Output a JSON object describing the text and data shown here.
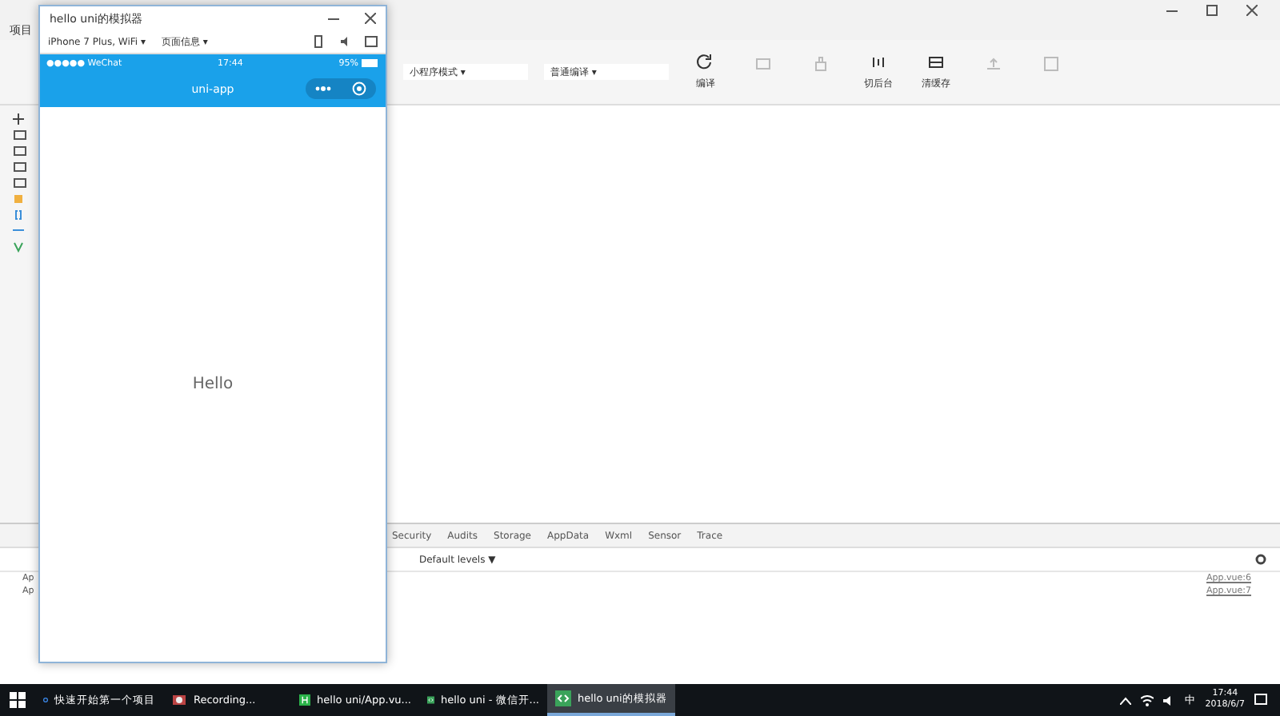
{
  "devtools": {
    "menu": "项目",
    "mode_select": "小程序模式",
    "mode_arrow": "▾",
    "compile_select": "普通编译",
    "compile_arrow": "▾",
    "toolbar": [
      {
        "label": "编译",
        "disabled": false
      },
      {
        "disabled": true
      },
      {
        "disabled": true
      },
      {
        "label": "切后台",
        "disabled": false
      },
      {
        "label": "清缓存",
        "disabled": false
      },
      {
        "disabled": true
      },
      {
        "disabled": true
      }
    ],
    "panel_tabs": [
      {
        "label": "Security",
        "selected": false
      },
      {
        "label": "Audits",
        "selected": false
      },
      {
        "label": "Storage",
        "selected": false
      },
      {
        "label": "AppData",
        "selected": false
      },
      {
        "label": "Wxml",
        "selected": false
      },
      {
        "label": "Sensor",
        "selected": false
      },
      {
        "label": "Trace",
        "selected": false
      }
    ],
    "levels": "Default levels ▼",
    "console": [
      {
        "text": "Ap",
        "source": "App.vue:6"
      },
      {
        "text": "Ap",
        "source": "App.vue:7"
      }
    ]
  },
  "simulator": {
    "title": "hello uni的模拟器",
    "device": "iPhone 7 Plus, WiFi ▾",
    "page_info": "页面信息 ▾",
    "carrier": "●●●●● WeChat",
    "time": "17:44",
    "battery": "95%",
    "nav_title": "uni-app",
    "content": "Hello"
  },
  "taskbar": {
    "items": [
      {
        "label": "快速开始第一个项目",
        "selected": false
      },
      {
        "label": "Recording...",
        "selected": false
      },
      {
        "label": "hello uni/App.vu...",
        "selected": false
      },
      {
        "label": "hello uni - 微信开...",
        "selected": false
      },
      {
        "label": "hello uni的模拟器",
        "selected": true
      }
    ],
    "ime": "中",
    "time": "17:44",
    "date": "2018/6/7"
  }
}
